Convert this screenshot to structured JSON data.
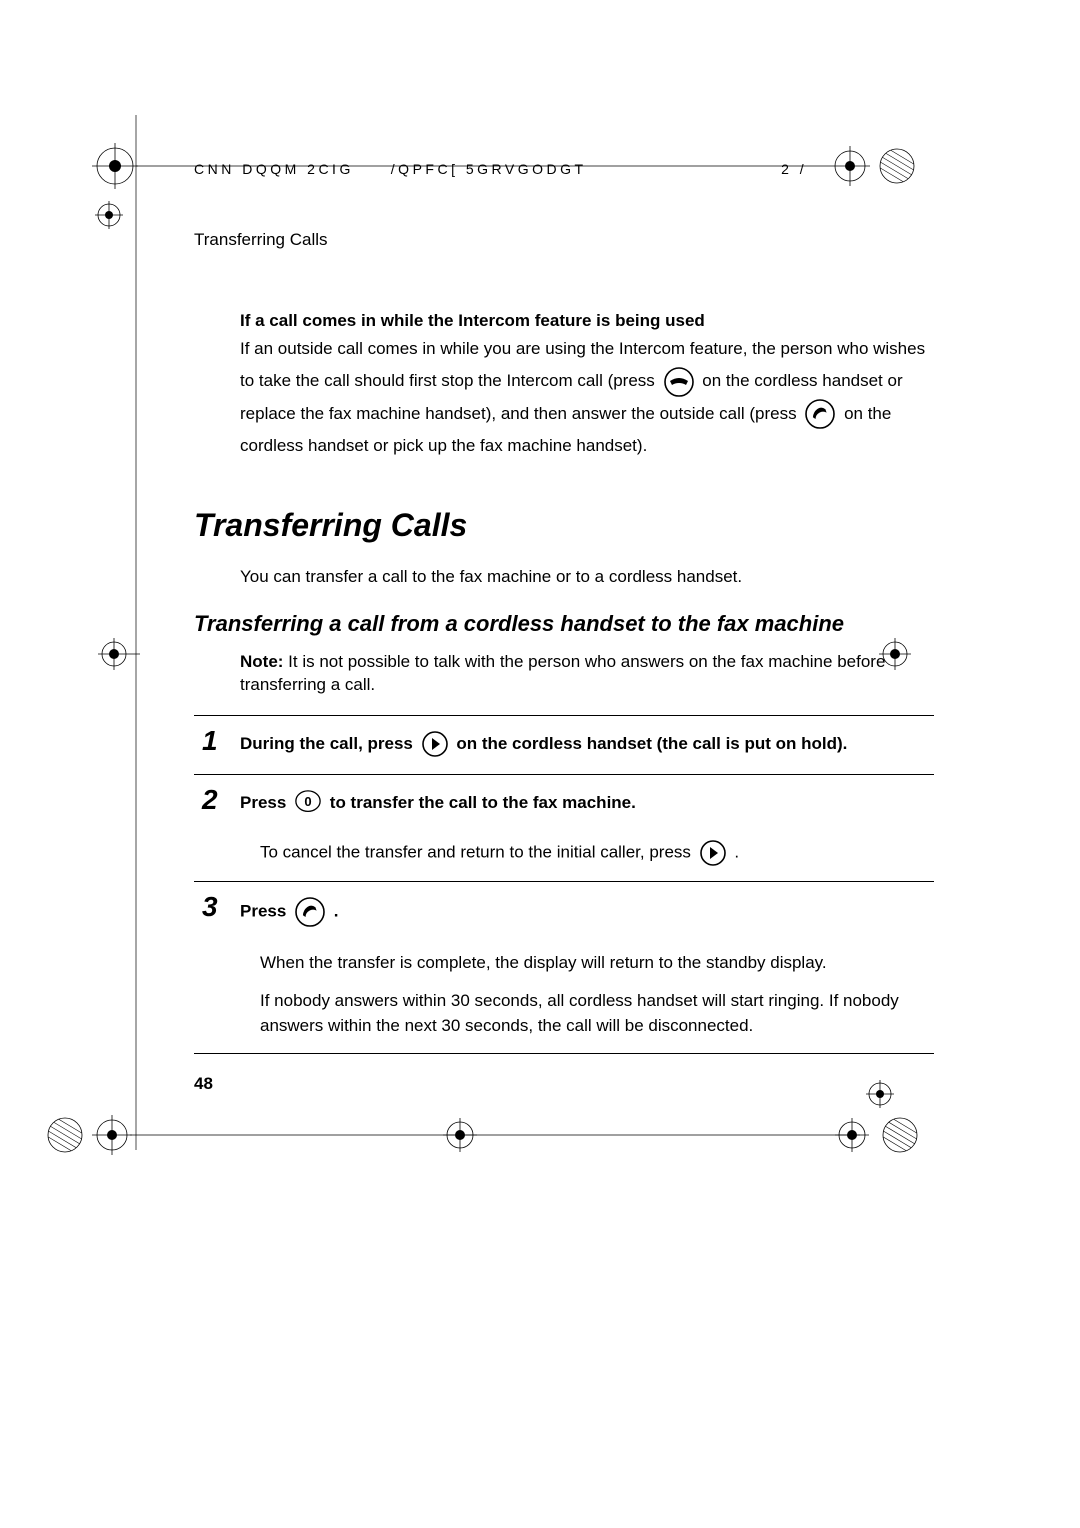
{
  "header": {
    "code_left": "CNN DQQM  2CIG",
    "code_mid": "/QPFC[  5GRVGODGT",
    "code_right": "2 /"
  },
  "running_title": "Transferring Calls",
  "intercom": {
    "heading": "If a call comes in while the Intercom feature is being used",
    "p1a": "If an outside call comes in while you are using the Intercom feature, the person who wishes to take the call should first stop the Intercom call (press ",
    "p1b": " on the cordless handset or replace the fax machine handset), and then answer the outside call (press ",
    "p1c": " on the cordless handset or pick up the fax machine handset)."
  },
  "section_title": "Transferring Calls",
  "intro": "You can transfer a call to the fax machine or to a cordless handset.",
  "sub_title": "Transferring a call from a cordless handset to the fax machine",
  "note_label": "Note:",
  "note_text": " It is not possible to talk with the person who answers on the fax machine before transferring a call.",
  "steps": {
    "s1": {
      "num": "1",
      "t1": "During the call, press ",
      "t2": " on the cordless handset (the call is put on hold)."
    },
    "s2": {
      "num": "2",
      "t1": "Press ",
      "t2": " to transfer the call to the fax machine.",
      "sub1": "To cancel the transfer and return to the initial caller, press ",
      "sub2": " ."
    },
    "s3": {
      "num": "3",
      "t1": "Press ",
      "t2": " .",
      "sub1": "When the transfer is complete, the display will return to the standby display.",
      "sub2": "If nobody answers within 30 seconds, all cordless handset will start ringing. If nobody answers within the next 30 seconds, the call will be disconnected."
    }
  },
  "page_number": "48",
  "icons": {
    "hangup": "hangup-icon",
    "talk": "talk-icon",
    "right": "right-arrow-icon",
    "zero": "zero-key-icon"
  }
}
